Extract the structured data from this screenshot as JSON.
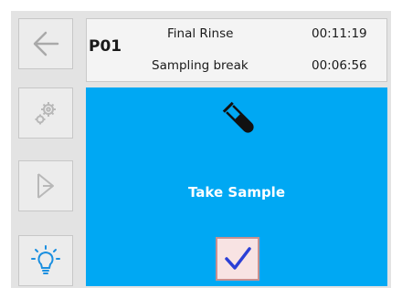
{
  "status": {
    "program": "P01",
    "phase_label": "Final Rinse",
    "phase_time": "00:11:19",
    "break_label": "Sampling break",
    "break_time": "00:06:56"
  },
  "main": {
    "prompt": "Take Sample",
    "icon": "test-tube-icon",
    "accent": "#00a8f3"
  },
  "sidebar": {
    "items": [
      {
        "icon": "back-arrow-icon"
      },
      {
        "icon": "gear-icon"
      },
      {
        "icon": "funnel-icon"
      },
      {
        "icon": "lightbulb-icon"
      }
    ]
  },
  "confirm": {
    "icon": "checkmark-icon",
    "color": "#2b3fd6"
  }
}
